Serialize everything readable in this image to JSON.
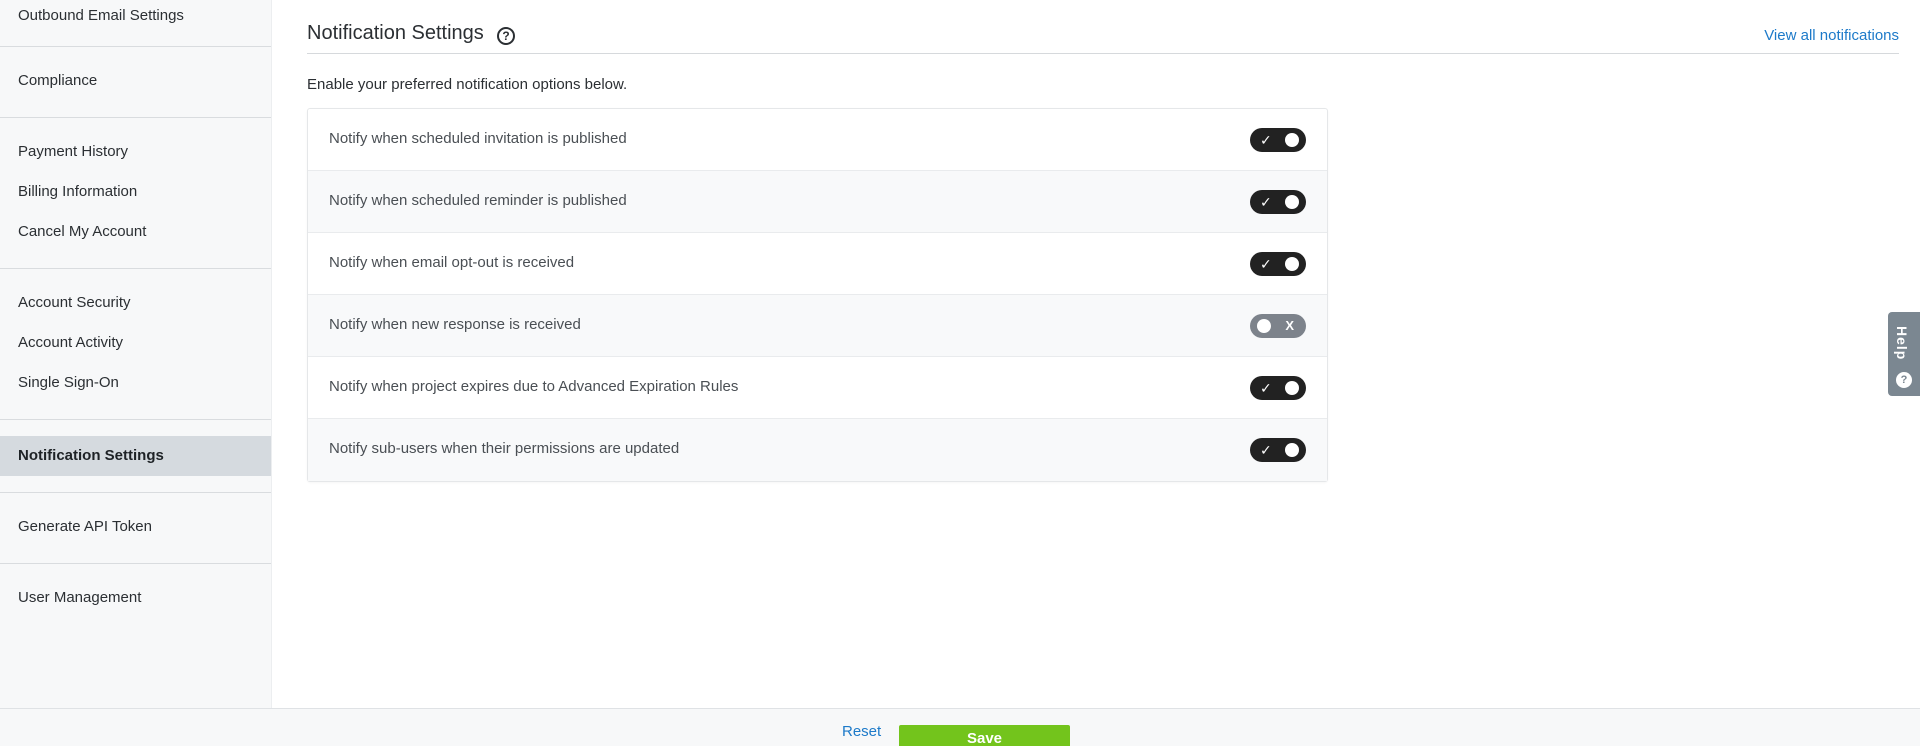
{
  "sidebar": {
    "groups": [
      {
        "items": [
          {
            "label": "Outbound Email Settings"
          }
        ]
      },
      {
        "items": [
          {
            "label": "Compliance"
          }
        ]
      },
      {
        "items": [
          {
            "label": "Payment History"
          },
          {
            "label": "Billing Information"
          },
          {
            "label": "Cancel My Account"
          }
        ]
      },
      {
        "items": [
          {
            "label": "Account Security"
          },
          {
            "label": "Account Activity"
          },
          {
            "label": "Single Sign-On"
          }
        ]
      },
      {
        "items": [
          {
            "label": "Notification Settings"
          }
        ]
      },
      {
        "items": [
          {
            "label": "Generate API Token"
          }
        ]
      },
      {
        "items": [
          {
            "label": "User Management"
          }
        ]
      }
    ]
  },
  "header": {
    "title": "Notification Settings",
    "help_icon": "question-circle-icon",
    "view_all": "View all notifications"
  },
  "subtitle": "Enable your preferred notification options below.",
  "notifications": [
    {
      "label": "Notify when scheduled invitation is published",
      "enabled": true
    },
    {
      "label": "Notify when scheduled reminder is published",
      "enabled": true
    },
    {
      "label": "Notify when email opt-out is received",
      "enabled": true
    },
    {
      "label": "Notify when new response is received",
      "enabled": false
    },
    {
      "label": "Notify when project expires due to Advanced Expiration Rules",
      "enabled": true
    },
    {
      "label": "Notify sub-users when their permissions are updated",
      "enabled": true
    }
  ],
  "help_tab": {
    "label": "Help"
  },
  "footer": {
    "reset": "Reset",
    "save": "Save"
  },
  "colors": {
    "link": "#1d7ac9",
    "save": "#73c41c",
    "toggle_on": "#222222",
    "toggle_off": "#7d838b",
    "active_nav": "#d5dadf"
  }
}
